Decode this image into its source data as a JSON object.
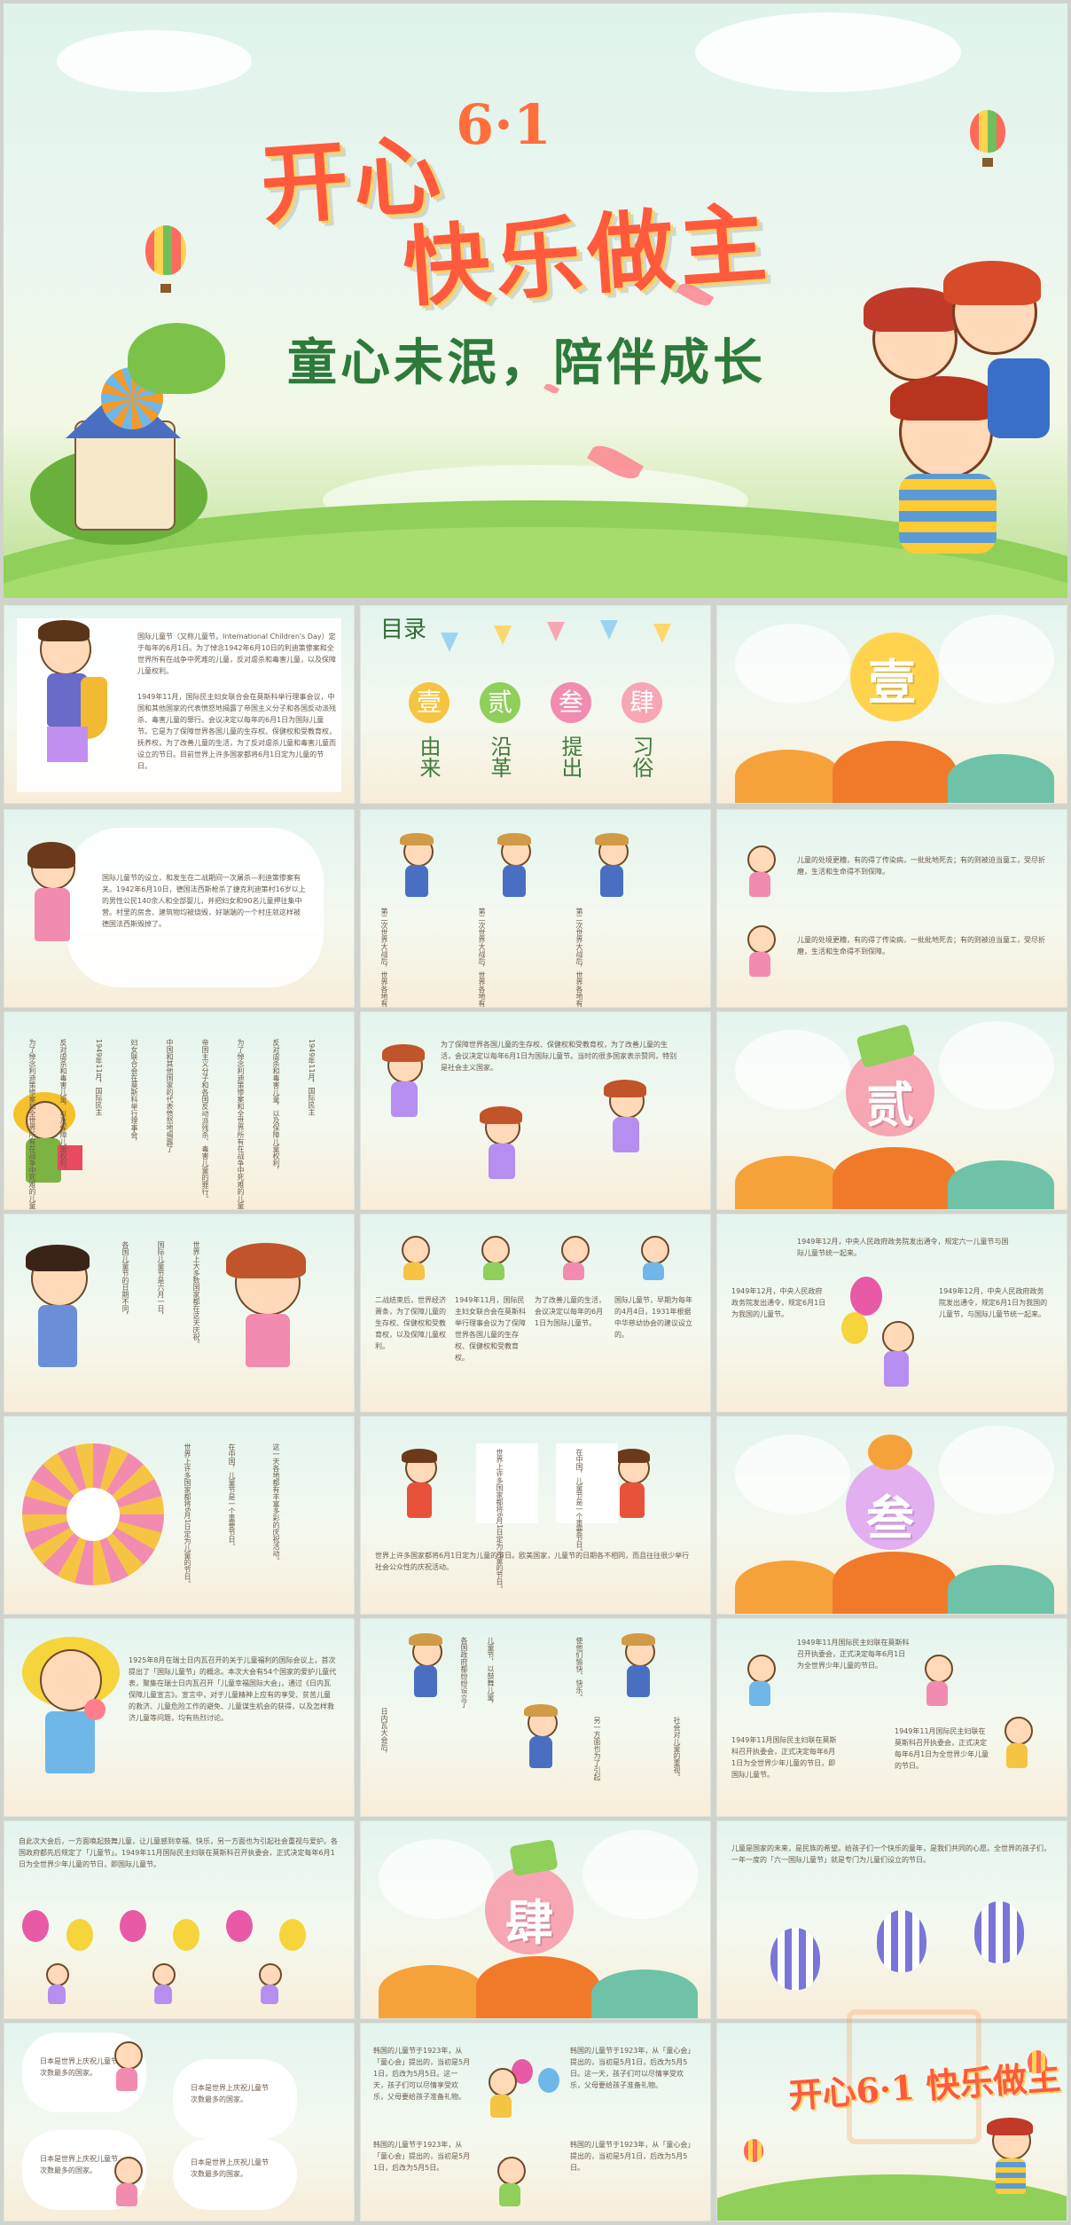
{
  "colors": {
    "accent": "#ff5a3c",
    "green": "#2d7a3b",
    "pink": "#f7a6b4",
    "orange": "#f6a23b"
  },
  "hero": {
    "title": "开心6·1 快乐做主",
    "title_line1": "开心",
    "title_num": "6·1",
    "title_line2": "快乐做主",
    "subtitle": "童心未泯，陪伴成长"
  },
  "toc": {
    "title": "目录",
    "items": [
      {
        "num": "壹",
        "label": "由来"
      },
      {
        "num": "贰",
        "label": "沿革"
      },
      {
        "num": "叁",
        "label": "提出"
      },
      {
        "num": "肆",
        "label": "习俗"
      }
    ]
  },
  "sections": {
    "one": "壹",
    "two": "贰",
    "three": "叁",
    "four": "肆"
  },
  "slides": {
    "s1_para1": "国际儿童节（又称儿童节，International Children's Day）定于每年的6月1日。为了悼念1942年6月10日的利迪策惨案和全世界所有在战争中死难的儿童，反对虐杀和毒害儿童，以及保障儿童权利。",
    "s1_para2": "1949年11月，国际民主妇女联合会在莫斯科举行理事会议，中国和其他国家的代表愤怒地揭露了帝国主义分子和各国反动派残杀、毒害儿童的罪行。会议决定以每年的6月1日为国际儿童节。它是为了保障世界各国儿童的生存权、保健权和受教育权，抚养权，为了改善儿童的生活，为了反对虐杀儿童和毒害儿童而设立的节日。目前世界上许多国家都将6月1日定为儿童的节日。",
    "s4_para": "国际儿童节的设立，和发生在二战期间一次屠杀—利迪策惨案有关。1942年6月10日，德国法西斯枪杀了捷克利迪策村16岁以上的男性公民140余人和全部婴儿，并把妇女和90名儿童押往集中营。村里的房舍、建筑物均被烧毁，好端端的一个村庄就这样被德国法西斯毁掉了。",
    "s5_col": "第二次世界大战后，世界各地有许多儿童死亡，或生活在饥饿和疾病中。",
    "s6_para": "儿童的处境更糟，有的得了传染病，一批批地死去；有的则被迫当童工，受尽折磨，生活和生命得不到保障。",
    "s7_cols": [
      "为了悼念利迪策惨案和全世界所有在战争中死难的儿童，",
      "反对虐杀和毒害儿童，以及保障儿童权利，",
      "1949年11月，国际民主",
      "妇女联合会在莫斯科举行理事会，",
      "中国和其他国家的代表愤怒地揭露了",
      "帝国主义分子和各国反动派残杀、毒害儿童的罪行。"
    ],
    "s8_para": "为了保障世界各国儿童的生存权、保健权和受教育权，为了改善儿童的生活，会议决定以每年6月1日为国际儿童节。当时的很多国家表示赞同，特别是社会主义国家。",
    "s10_cols": [
      "各国儿童节的日期不同，",
      "国际儿童节是六月一日，",
      "世界上大多数国家都在这天庆祝。"
    ],
    "s11_col1": "二战结束后，世界经济萧条，为了保障儿童的生存权、保健权和受教育权，以及保障儿童权利。",
    "s11_col2": "1949年11月，国际民主妇女联合会在莫斯科举行理事会议为了保障世界各国儿童的生存权、保健权和受教育权。",
    "s11_col3": "为了改善儿童的生活，会议决定以每年的6月1日为国际儿童节。",
    "s11_col4": "国际儿童节，早期为每年的4月4日，1931年根据中华慈幼协会的建议设立的。",
    "s12_para1": "1949年12月，中央人民政府政务院发出通令，规定六一儿童节与国际儿童节统一起来。",
    "s12_para2": "1949年12月，中央人民政府政务院发出通令，规定6月1日为我国的儿童节。",
    "s12_para3": "1949年12月，中央人民政府政务院发出通令，规定6月1日为我国的儿童节，与国际儿童节统一起来。",
    "s14_cols": [
      "世界上许多国家都将6月1日定为儿童的节日。",
      "在中国，儿童节是一个重要节日。",
      "这一天各地都有丰富多彩的庆祝活动。"
    ],
    "s15_para": "世界上许多国家都将6月1日定为儿童的节日。欧美国家，儿童节的日期各不相同，而且往往很少举行社会公众性的庆祝活动。",
    "s17_para": "1925年8月在瑞士日内瓦召开的关于儿童福利的国际会议上，首次提出了「国际儿童节」的概念。本次大会有54个国家的爱护儿童代表，聚集在瑞士日内瓦召开「儿童幸福国际大会」，通过《日内瓦保障儿童宣言》。宣言中，对于儿童精神上应有的享受、贫苦儿童的救济、儿童危险工作的避免、儿童谋生机会的获得，以及怎样救济儿童等问题，均有热烈讨论。",
    "s18_cols": [
      "日内瓦大会后，",
      "各国政府都纷纷设立了",
      "儿童节，以鼓舞儿童，",
      "使他们愉快、快乐。",
      "另一方面也为了引起",
      "社会对儿童的重视。"
    ],
    "s19_para1": "1949年11月国际民主妇联在莫斯科召开执委会，正式决定每年6月1日为全世界少年儿童的节日。",
    "s19_para2": "1949年11月国际民主妇联在莫斯科召开执委会，正式决定每年6月1日为全世界少年儿童的节日，即国际儿童节。",
    "s19_para3": "1949年11月国际民主妇联在莫斯科召开执委会，正式决定每年6月1日为全世界少年儿童的节日。",
    "s20_para": "自此次大会后，一方面唤起鼓舞儿童，让儿童感到幸福、快乐，另一方面也为引起社会重视与爱护。各国政府都先后规定了「儿童节」。1949年11月国际民主妇联在莫斯科召开执委会，正式决定每年6月1日为全世界少年儿童的节日，即国际儿童节。",
    "s22_para": "儿童是国家的未来，是民族的希望。给孩子们一个快乐的童年，是我们共同的心愿。全世界的孩子们，一年一度的「六一国际儿童节」就是专门为儿童们设立的节日。",
    "s23_para1": "日本是世界上庆祝儿童节次数最多的国家。",
    "s23_para2": "日本是世界上庆祝儿童节次数最多的国家。",
    "s23_para3": "日本是世界上庆祝儿童节次数最多的国家。",
    "s23_para4": "日本是世界上庆祝儿童节次数最多的国家。",
    "s24_para1": "韩国的儿童节于1923年，从「童心会」提出的，当初是5月1日，后改为5月5日。这一天，孩子们可以尽情享受欢乐，父母要给孩子准备礼物。",
    "s24_para2": "韩国的儿童节于1923年，从「童心会」提出的，当初是5月1日，后改为5月5日。这一天，孩子们可以尽情享受欢乐，父母要给孩子准备礼物。",
    "s24_para3": "韩国的儿童节于1923年，从「童心会」提出的，当初是5月1日，后改为5月5日。",
    "s24_para4": "韩国的儿童节于1923年，从「童心会」提出的，当初是5月1日，后改为5月5日。"
  },
  "end": {
    "title": "开心6·1 快乐做主"
  }
}
